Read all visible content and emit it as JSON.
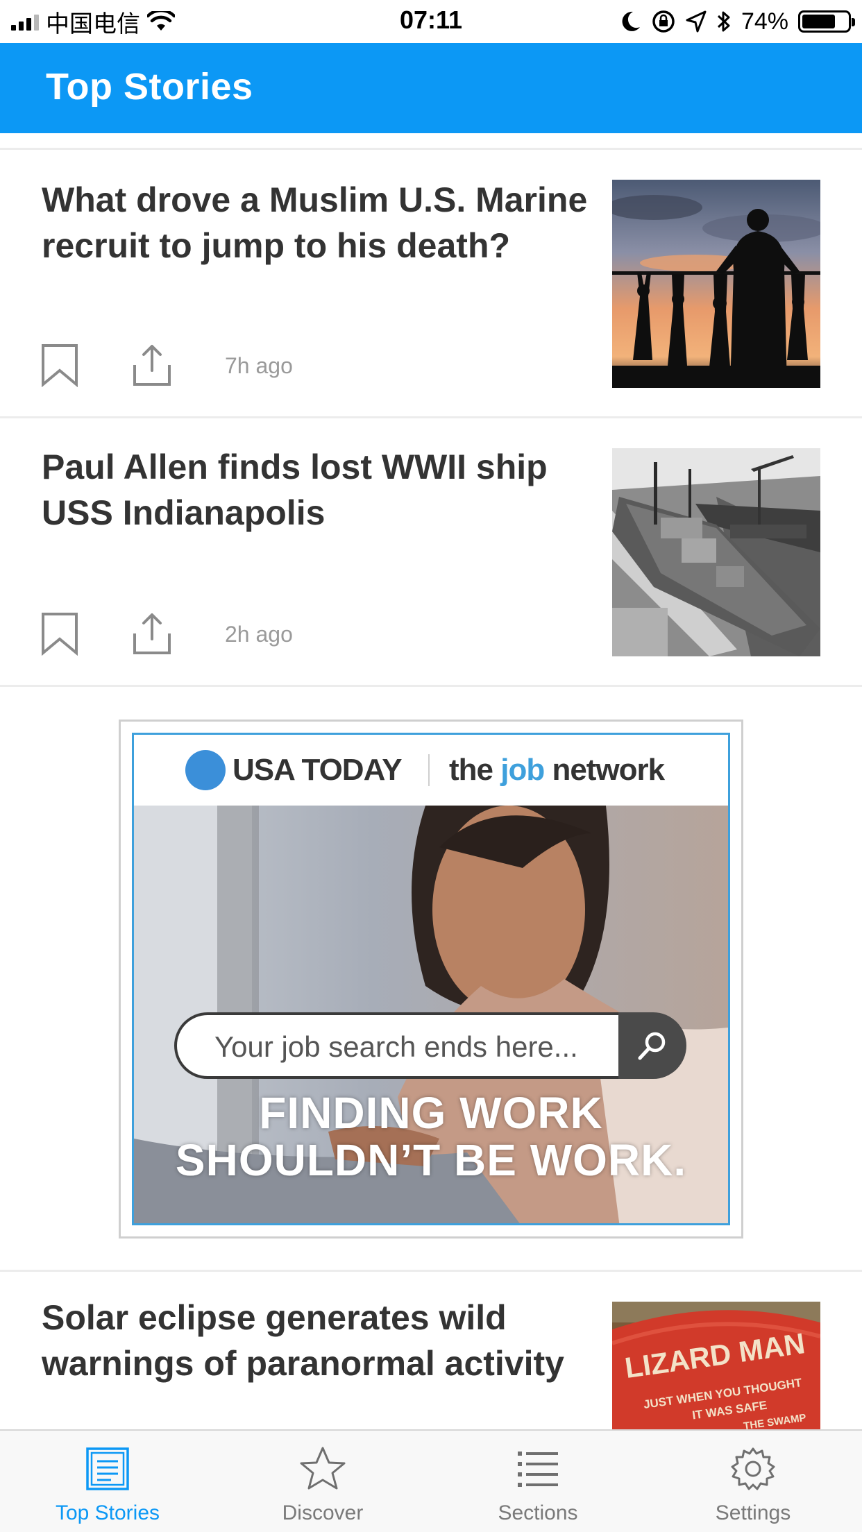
{
  "status_bar": {
    "carrier": "中国电信",
    "time": "07:11",
    "battery_percent": "74%",
    "battery_level": 0.74,
    "icons": [
      "signal-icon",
      "wifi-icon",
      "moon-icon",
      "rotation-lock-icon",
      "location-icon",
      "bluetooth-icon",
      "battery-icon"
    ]
  },
  "header": {
    "title": "Top Stories",
    "accent_color": "#0c98f5"
  },
  "stories": [
    {
      "title": "What drove a Muslim U.S. Marine recruit to jump to his death?",
      "time": "7h ago",
      "thumbnail": "silhouettes-on-bar-photo"
    },
    {
      "title": "Paul Allen finds lost WWII ship USS Indianapolis",
      "time": "2h ago",
      "thumbnail": "warship-photo"
    },
    {
      "title": "Solar eclipse generates wild warnings of paranormal activity",
      "thumbnail": "lizard-man-hat-photo",
      "thumbnail_text": [
        "LIZARD MAN",
        "JUST WHEN YOU THOUGHT",
        "IT WAS SAFE",
        "THE SWAMP"
      ]
    }
  ],
  "ad": {
    "brand": "USA TODAY",
    "partner_prefix": "the ",
    "partner_highlight": "job",
    "partner_suffix": " network",
    "search_placeholder": "Your job search ends here...",
    "tagline_line1": "FINDING WORK",
    "tagline_line2": "SHOULDN’T BE WORK."
  },
  "tab_bar": {
    "tabs": [
      {
        "label": "Top Stories",
        "icon": "newspaper-icon",
        "active": true
      },
      {
        "label": "Discover",
        "icon": "star-icon",
        "active": false
      },
      {
        "label": "Sections",
        "icon": "list-icon",
        "active": false
      },
      {
        "label": "Settings",
        "icon": "gear-icon",
        "active": false
      }
    ]
  }
}
